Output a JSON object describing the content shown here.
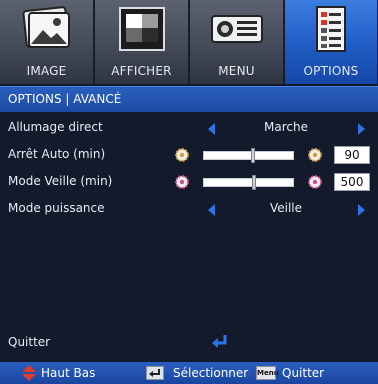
{
  "tabs": [
    {
      "label": "IMAGE",
      "icon": "image-icon",
      "active": false
    },
    {
      "label": "AFFICHER",
      "icon": "display-icon",
      "active": false
    },
    {
      "label": "MENU",
      "icon": "projector-icon",
      "active": false
    },
    {
      "label": "OPTIONS",
      "icon": "options-list-icon",
      "active": true
    }
  ],
  "section_title": "OPTIONS | AVANCÉ",
  "rows": {
    "allumage": {
      "label": "Allumage direct",
      "value": "Marche"
    },
    "arret": {
      "label": "Arrêt Auto (min)",
      "value": "90",
      "level": 0.55
    },
    "veille": {
      "label": "Mode Veille (min)",
      "value": "500",
      "level": 0.56
    },
    "puissance": {
      "label": "Mode puissance",
      "value": "Veille"
    }
  },
  "quit_label": "Quitter",
  "footer": {
    "nav": "Haut Bas",
    "select": "Sélectionner",
    "menu_key": "Menu",
    "quit": "Quitter"
  },
  "colors": {
    "accent": "#2f72e8",
    "active_tab": "#1f5cc4",
    "header_bar": "#1b4aa3",
    "background": "#121a2c"
  }
}
